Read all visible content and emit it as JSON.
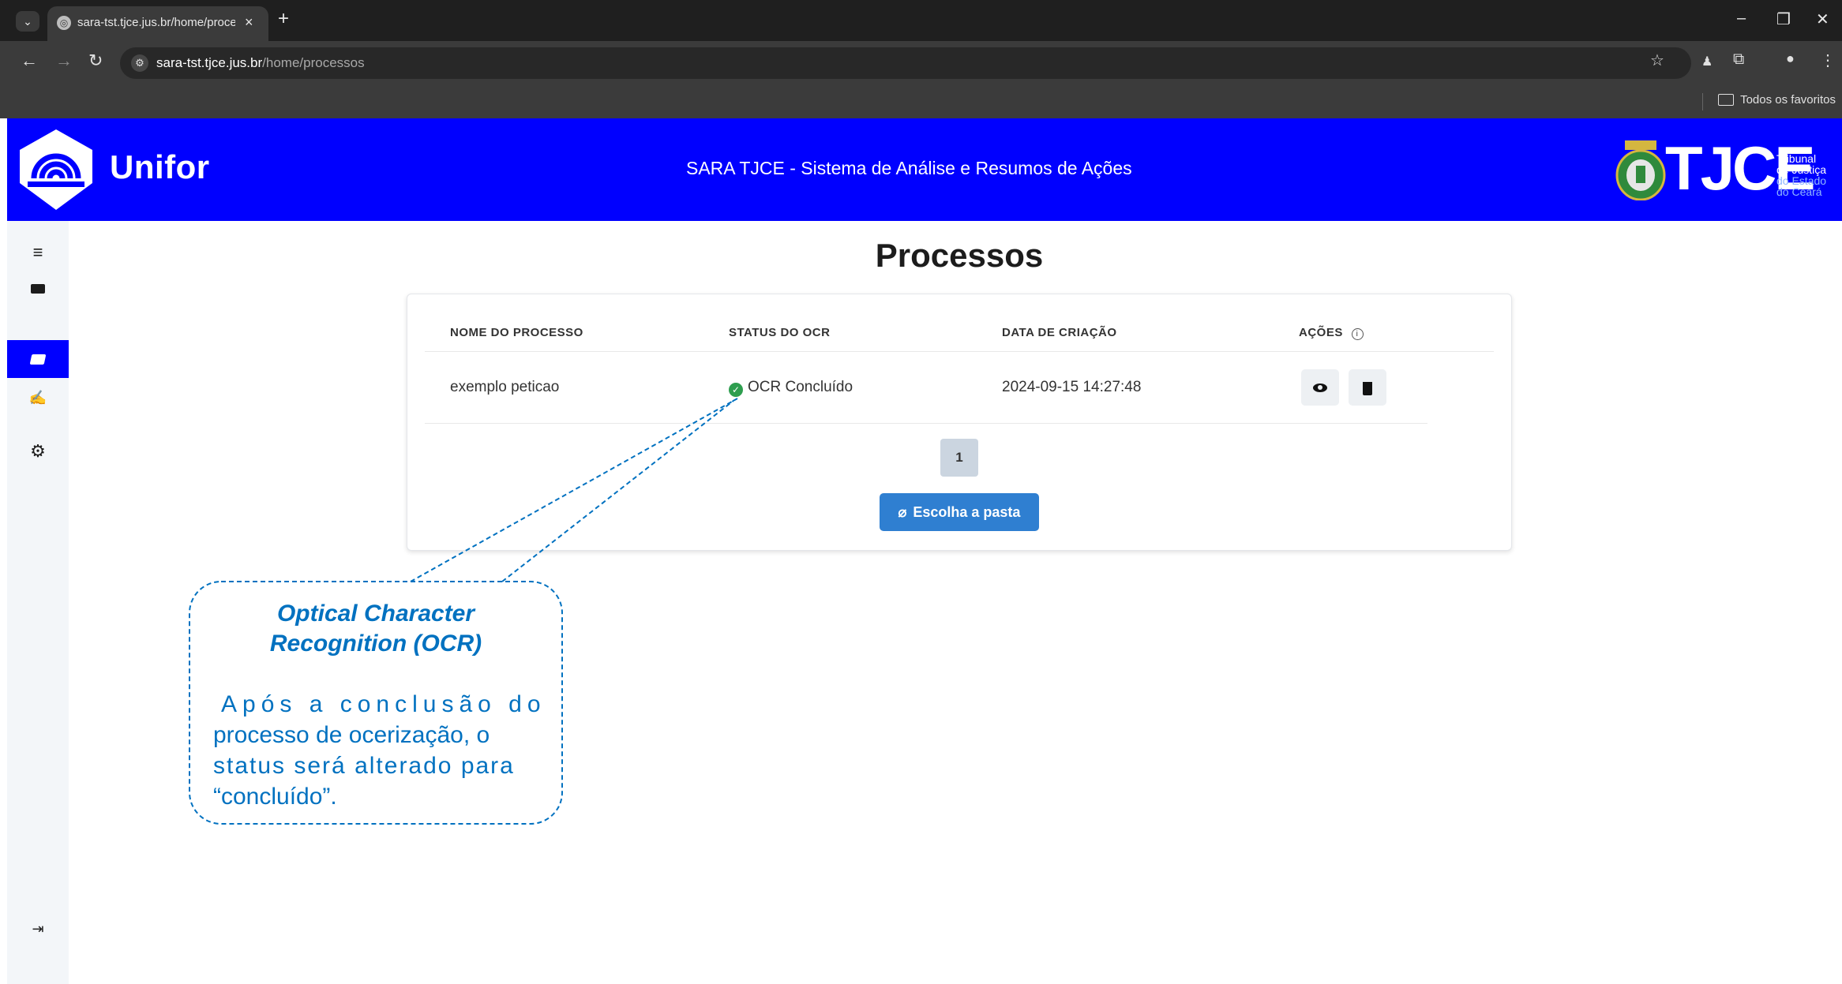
{
  "browser": {
    "tab_title": "sara-tst.tjce.jus.br/home/proce:",
    "tab_close": "×",
    "new_tab": "+",
    "url_host": "sara-tst.tjce.jus.br",
    "url_path": "/home/processos",
    "bookmarks_folder": "Todos os favoritos"
  },
  "header": {
    "brand": "Unifor",
    "title": "SARA TJCE - Sistema de Análise e Resumos de Ações",
    "tjce_logo_text": "TJCE",
    "tjce_sub": [
      "Tribunal",
      "de Justiça",
      "do Estado",
      "do Ceará"
    ]
  },
  "sidebar": {
    "items": [
      {
        "icon": "menu-icon"
      },
      {
        "icon": "keyboard-icon"
      },
      {
        "icon": "folder-open-icon",
        "active": true
      },
      {
        "icon": "file-signature-icon"
      },
      {
        "icon": "gear-icon"
      },
      {
        "icon": "logout-icon"
      }
    ]
  },
  "main": {
    "page_title": "Processos",
    "table": {
      "headers": [
        "NOME DO PROCESSO",
        "STATUS DO OCR",
        "DATA DE CRIAÇÃO",
        "AÇÕES"
      ],
      "rows": [
        {
          "name": "exemplo peticao",
          "status": "OCR Concluído",
          "date": "2024-09-15 14:27:48"
        }
      ]
    },
    "pagination": {
      "current_page": "1"
    },
    "choose_folder_label": "Escolha a pasta"
  },
  "callout": {
    "title_line1": "Optical Character",
    "title_line2": "Recognition (OCR)",
    "body_line1": "Após a conclusão do",
    "body_line2": "processo de ocerização, o",
    "body_line3": "status será alterado para",
    "body_line4": "“concluído”."
  },
  "colors": {
    "header_bg": "#0000ff",
    "sidebar_active": "#0000ff",
    "primary_button": "#2f7fd1",
    "status_ok": "#2e9e4f",
    "callout": "#0071c0"
  }
}
